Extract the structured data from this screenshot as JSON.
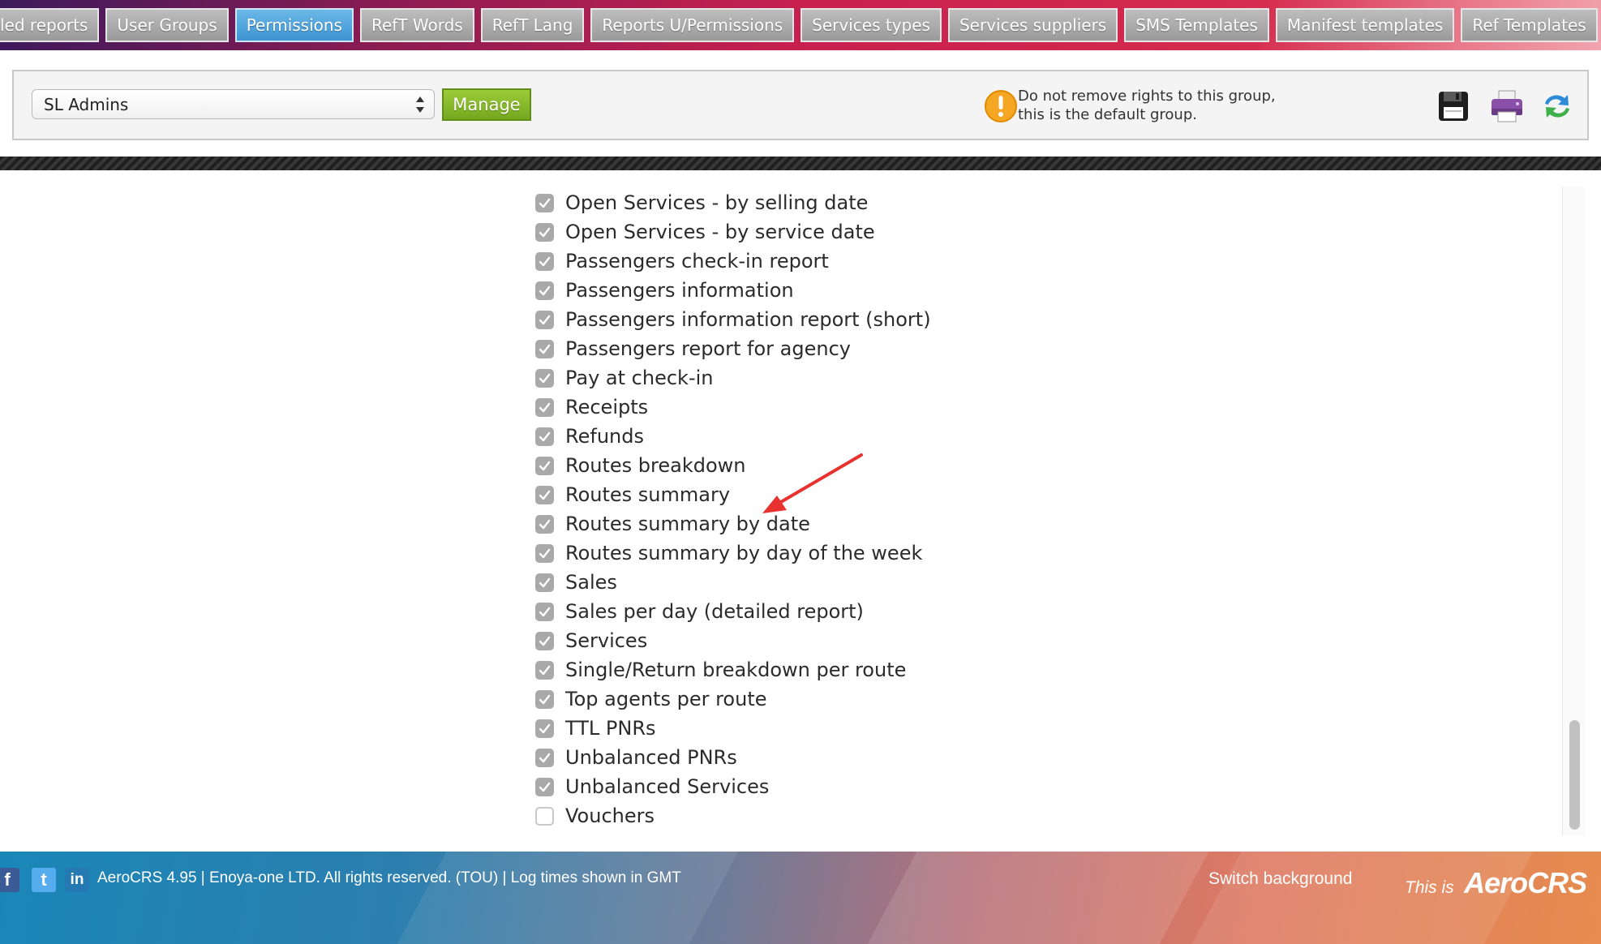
{
  "tabs": [
    {
      "label": "led reports",
      "active": false
    },
    {
      "label": "User Groups",
      "active": false
    },
    {
      "label": "Permissions",
      "active": true
    },
    {
      "label": "RefT Words",
      "active": false
    },
    {
      "label": "RefT Lang",
      "active": false
    },
    {
      "label": "Reports U/Permissions",
      "active": false
    },
    {
      "label": "Services types",
      "active": false
    },
    {
      "label": "Services suppliers",
      "active": false
    },
    {
      "label": "SMS Templates",
      "active": false
    },
    {
      "label": "Manifest templates",
      "active": false
    },
    {
      "label": "Ref Templates",
      "active": false
    }
  ],
  "toolbar": {
    "group_selected": "SL Admins",
    "manage_label": "Manage",
    "warning_line1": "Do not remove rights to this group,",
    "warning_line2": "this is the default group.",
    "icons": [
      "save-icon",
      "print-icon",
      "refresh-icon"
    ]
  },
  "permissions": [
    {
      "label": "Open Services - by selling date",
      "checked": true
    },
    {
      "label": "Open Services - by service date",
      "checked": true
    },
    {
      "label": "Passengers check-in report",
      "checked": true
    },
    {
      "label": "Passengers information",
      "checked": true
    },
    {
      "label": "Passengers information report (short)",
      "checked": true
    },
    {
      "label": "Passengers report for agency",
      "checked": true
    },
    {
      "label": "Pay at check-in",
      "checked": true
    },
    {
      "label": "Receipts",
      "checked": true
    },
    {
      "label": "Refunds",
      "checked": true
    },
    {
      "label": "Routes breakdown",
      "checked": true
    },
    {
      "label": "Routes summary",
      "checked": true
    },
    {
      "label": "Routes summary by date",
      "checked": true
    },
    {
      "label": "Routes summary by day of the week",
      "checked": true
    },
    {
      "label": "Sales",
      "checked": true
    },
    {
      "label": "Sales per day (detailed report)",
      "checked": true
    },
    {
      "label": "Services",
      "checked": true
    },
    {
      "label": "Single/Return breakdown per route",
      "checked": true
    },
    {
      "label": "Top agents per route",
      "checked": true
    },
    {
      "label": "TTL PNRs",
      "checked": true
    },
    {
      "label": "Unbalanced PNRs",
      "checked": true
    },
    {
      "label": "Unbalanced Services",
      "checked": true
    },
    {
      "label": "Vouchers",
      "checked": false
    }
  ],
  "footer": {
    "social_fb": "f",
    "social_tw": "t",
    "social_li": "in",
    "copyright": "AeroCRS 4.95  | Enoya-one LTD. All rights reserved. (TOU)  | Log times shown in GMT",
    "switch_background": "Switch background",
    "brand_prefix": "This is",
    "brand_logo": "AeroCRS"
  },
  "colors": {
    "active_tab": "#3d94d2",
    "manage_button": "#74a81e",
    "checkbox_checked": "#a9a9a9",
    "annotation_arrow": "#e8322f"
  }
}
